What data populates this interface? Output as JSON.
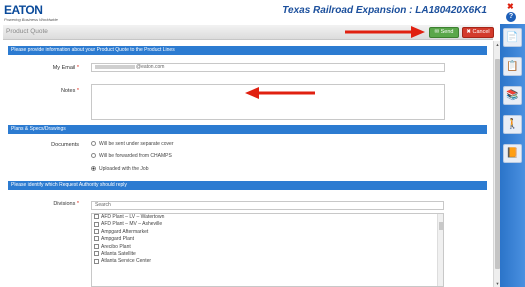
{
  "header": {
    "logo": "EATON",
    "tagline": "Powering Business Worldwide",
    "project_title": "Texas Railroad Expansion : LA180420X6K1",
    "close_glyph": "✖",
    "help_glyph": "?"
  },
  "toolbar": {
    "title": "Product Quote",
    "send_label": "✉ Send",
    "cancel_label": "✖ Cancel",
    "send_color": "#5aa74a",
    "cancel_color": "#d33b2c"
  },
  "sections": {
    "info": "Please provide information about your Product Quote to the Product Lines",
    "plans": "Plans & Specs/Drawings",
    "authority": "Please identify which Request Authority should reply"
  },
  "form": {
    "email_label": "My Email",
    "email_value": "@eaton.com",
    "notes_label": "Notes",
    "documents_label": "Documents",
    "divisions_label": "Divisions",
    "search_placeholder": "Search",
    "required_mark": "*"
  },
  "documents_options": [
    {
      "label": "Will be sent under separate cover",
      "selected": false
    },
    {
      "label": "Will be forwarded from CHAMPS",
      "selected": false
    },
    {
      "label": "Uploaded with the Job",
      "selected": true
    }
  ],
  "divisions": [
    "AFD Plant – LV – Watertown",
    "AFD Plant – MV – Asheville",
    "Ampgard Aftermarket",
    "Ampgard Plant",
    "Arecibo Plant",
    "Atlanta Satellite",
    "Atlanta Service Center"
  ],
  "sidebar_icons": [
    "document-icon",
    "list-icon",
    "books-icon",
    "person-icon",
    "edit-books-icon"
  ],
  "accent_color": "#2c7bd1"
}
